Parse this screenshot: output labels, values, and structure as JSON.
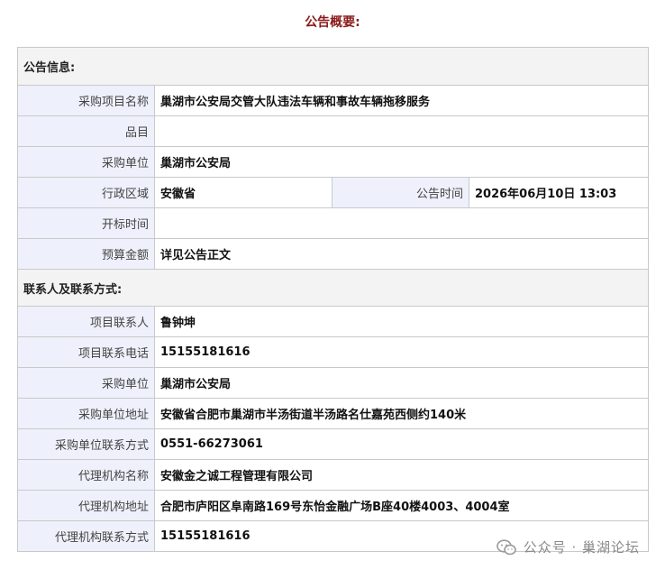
{
  "title": "公告概要:",
  "section_notice": "公告信息:",
  "section_contact": "联系人及联系方式:",
  "notice": {
    "project_name_label": "采购项目名称",
    "project_name": "巢湖市公安局交管大队违法车辆和事故车辆拖移服务",
    "category_label": "品目",
    "category": "",
    "purchaser_label": "采购单位",
    "purchaser": "巢湖市公安局",
    "region_label": "行政区域",
    "region": "安徽省",
    "publish_time_label": "公告时间",
    "publish_time": "2026年06月10日 13:03",
    "bid_open_label": "开标时间",
    "bid_open": "",
    "budget_label": "预算金额",
    "budget": "详见公告正文"
  },
  "contact": {
    "project_contact_label": "项目联系人",
    "project_contact": "鲁钟坤",
    "project_phone_label": "项目联系电话",
    "project_phone": "15155181616",
    "purchaser_label": "采购单位",
    "purchaser": "巢湖市公安局",
    "purchaser_addr_label": "采购单位地址",
    "purchaser_addr": "安徽省合肥市巢湖市半汤街道半汤路名仕嘉苑西侧约140米",
    "purchaser_contact_label": "采购单位联系方式",
    "purchaser_contact": "0551-66273061",
    "agency_name_label": "代理机构名称",
    "agency_name": "安徽金之诚工程管理有限公司",
    "agency_addr_label": "代理机构地址",
    "agency_addr": "合肥市庐阳区阜南路169号东怡金融广场B座40楼4003、4004室",
    "agency_contact_label": "代理机构联系方式",
    "agency_contact": "15155181616"
  },
  "watermark": {
    "icon": "wechat-icon",
    "text": "公众号 · 巢湖论坛"
  }
}
